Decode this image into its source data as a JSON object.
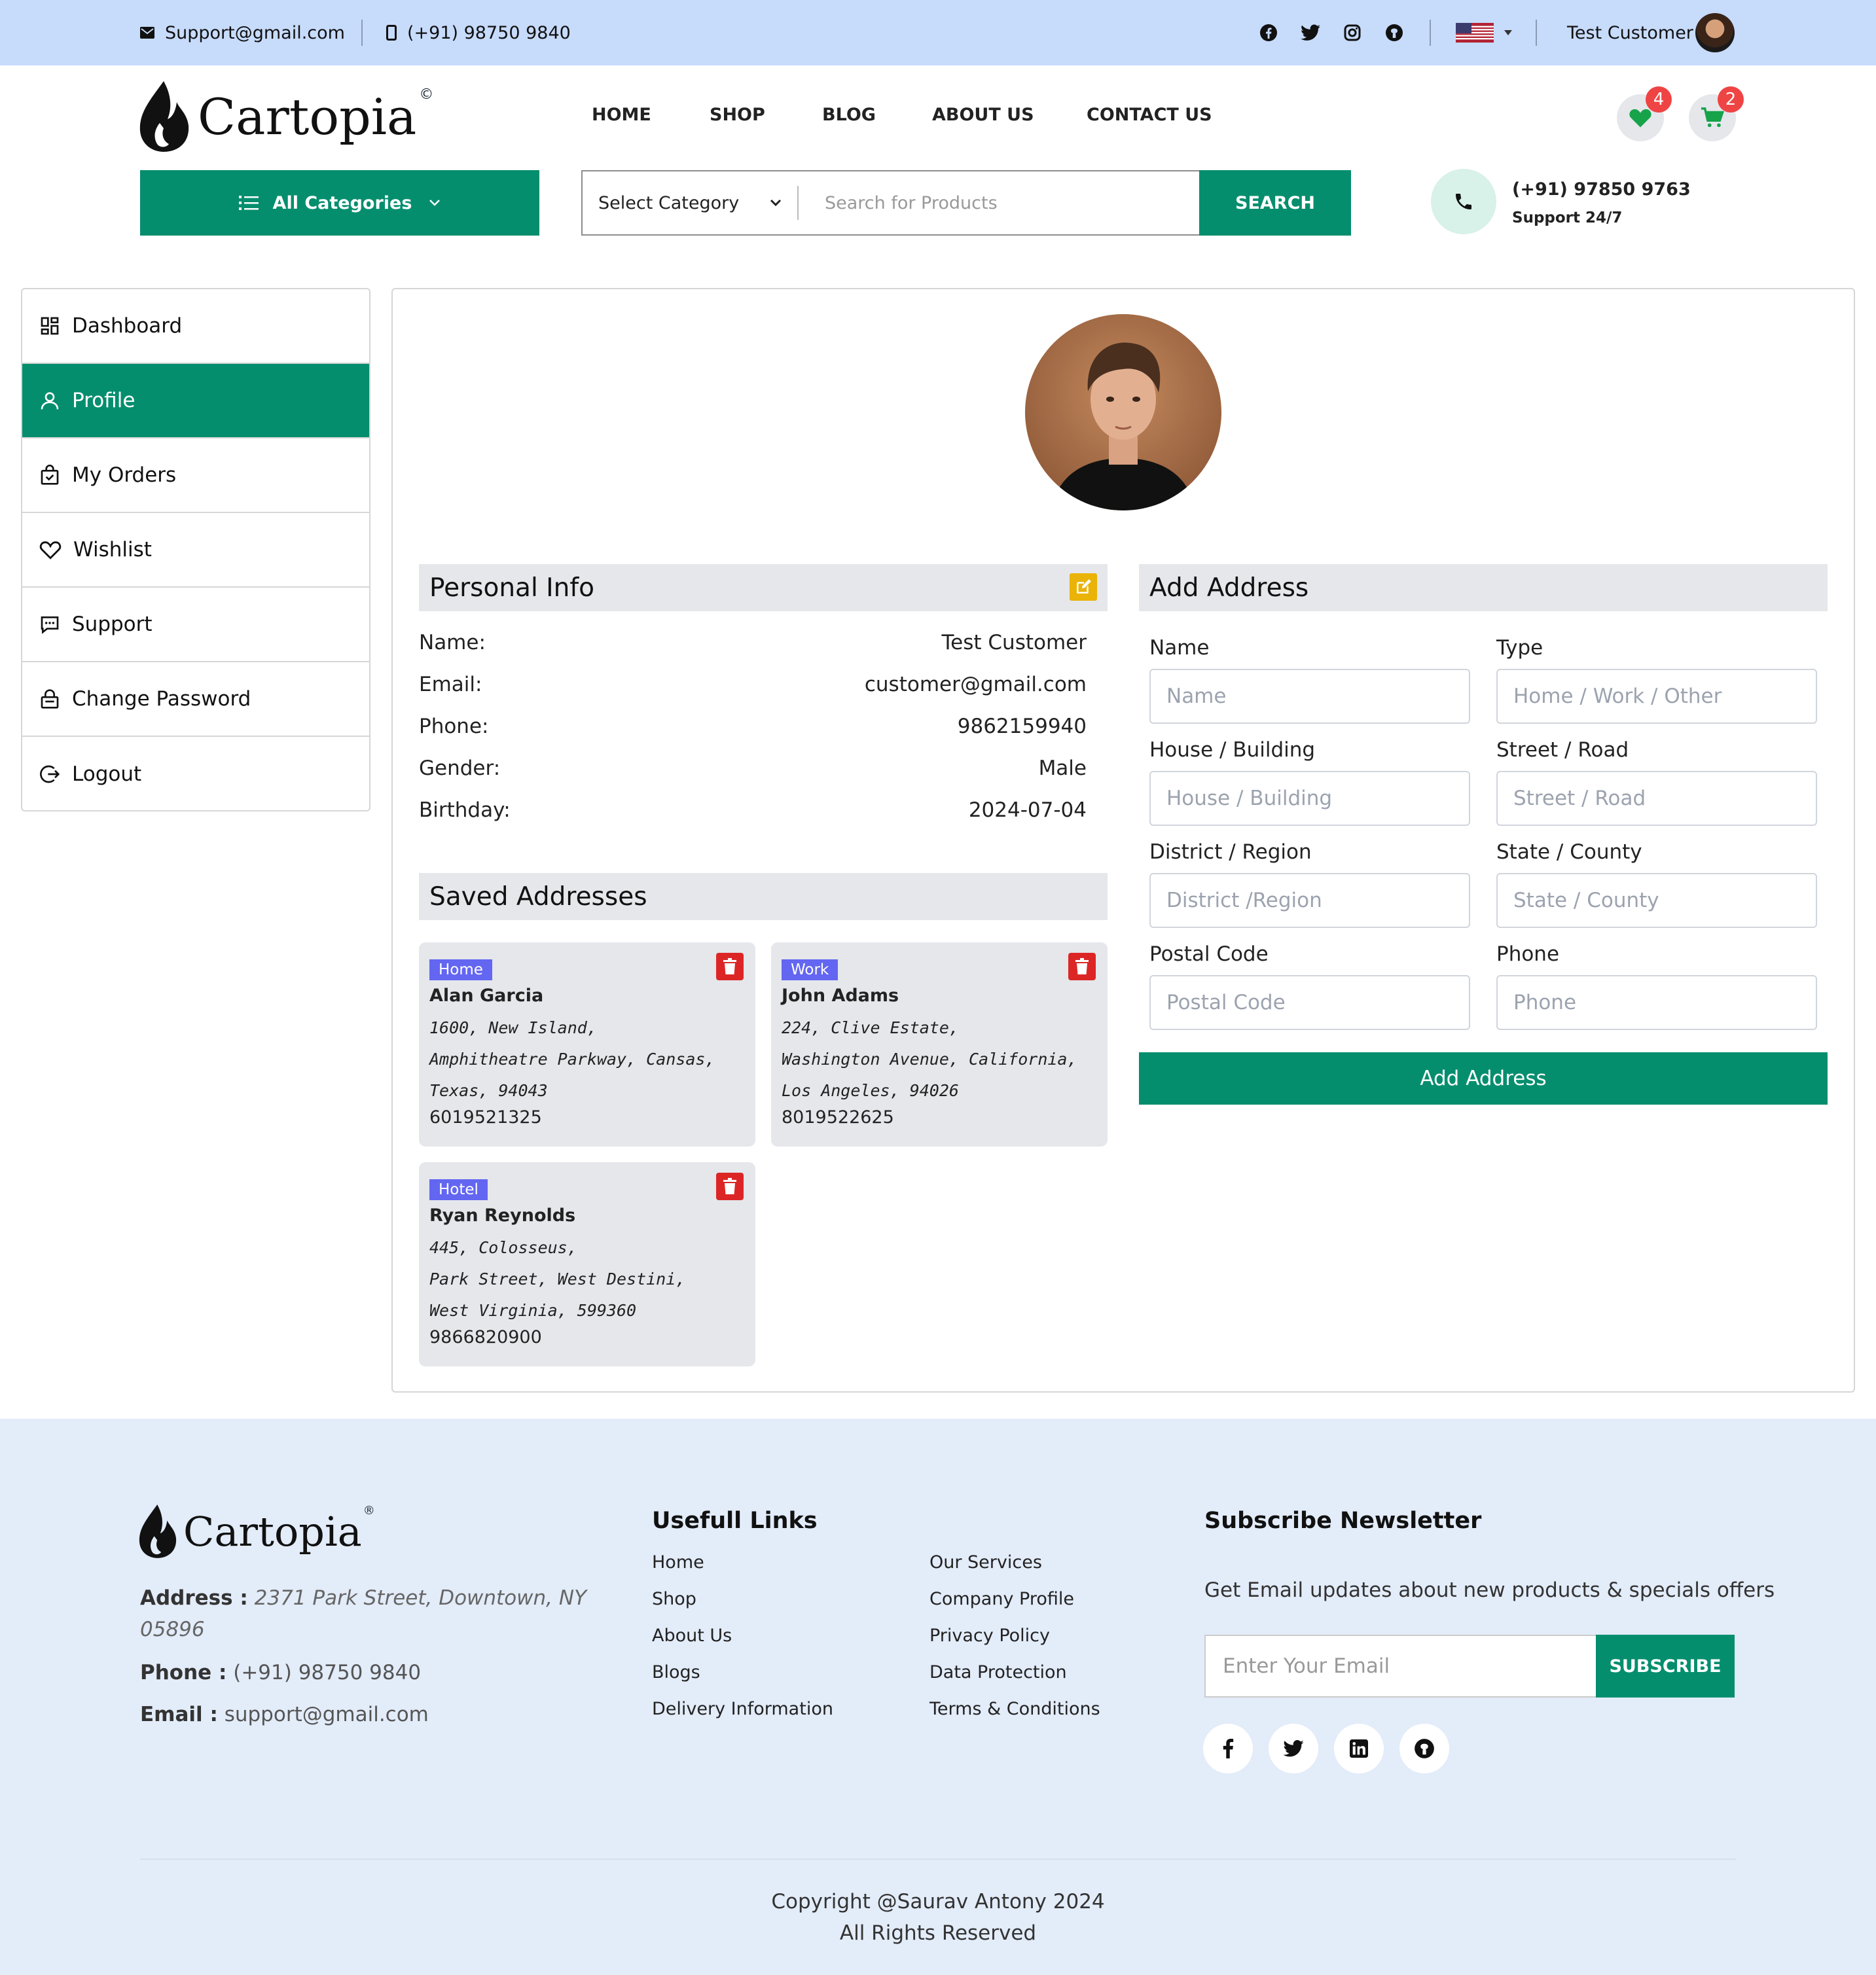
{
  "topbar": {
    "email": "Support@gmail.com",
    "phone": "(+91) 98750 9840",
    "user_name": "Test Customer",
    "social_icons": [
      "facebook-icon",
      "twitter-icon",
      "instagram-icon",
      "github-icon"
    ]
  },
  "header": {
    "brand": "Cartopia",
    "brand_mark": "©",
    "nav": [
      "HOME",
      "SHOP",
      "BLOG",
      "ABOUT US",
      "CONTACT US"
    ],
    "wishlist_count": "4",
    "cart_count": "2",
    "all_categories": "All Categories",
    "select_category": "Select Category",
    "search_placeholder": "Search for Products",
    "search_button": "SEARCH",
    "support_phone": "(+91) 97850 9763",
    "support_label": "Support 24/7"
  },
  "sidebar": {
    "items": [
      {
        "label": "Dashboard",
        "icon": "dashboard-icon"
      },
      {
        "label": "Profile",
        "icon": "user-icon"
      },
      {
        "label": "My Orders",
        "icon": "shopping-bag-icon"
      },
      {
        "label": "Wishlist",
        "icon": "heart-icon"
      },
      {
        "label": "Support",
        "icon": "chat-icon"
      },
      {
        "label": "Change Password",
        "icon": "lock-icon"
      },
      {
        "label": "Logout",
        "icon": "logout-icon"
      }
    ],
    "active": "Profile"
  },
  "personal_info": {
    "title": "Personal Info",
    "rows": [
      {
        "label": "Name:",
        "value": "Test Customer"
      },
      {
        "label": "Email:",
        "value": "customer@gmail.com"
      },
      {
        "label": "Phone:",
        "value": "9862159940"
      },
      {
        "label": "Gender:",
        "value": "Male"
      },
      {
        "label": "Birthday:",
        "value": "2024-07-04"
      }
    ]
  },
  "saved_addresses": {
    "title": "Saved Addresses",
    "cards": [
      {
        "tag": "Home",
        "name": "Alan Garcia",
        "lines": [
          "1600, New Island,",
          "Amphitheatre Parkway, Cansas,",
          "Texas, 94043"
        ],
        "phone": "6019521325"
      },
      {
        "tag": "Work",
        "name": "John Adams",
        "lines": [
          "224, Clive Estate,",
          "Washington Avenue, California,",
          "Los Angeles, 94026"
        ],
        "phone": "8019522625"
      },
      {
        "tag": "Hotel",
        "name": "Ryan Reynolds",
        "lines": [
          "445, Colosseus,",
          "Park Street, West Destini,",
          "West Virginia, 599360"
        ],
        "phone": "9866820900"
      }
    ]
  },
  "add_address": {
    "title": "Add Address",
    "fields": [
      {
        "label": "Name",
        "placeholder": "Name"
      },
      {
        "label": "Type",
        "placeholder": "Home / Work / Other"
      },
      {
        "label": "House / Building",
        "placeholder": "House / Building"
      },
      {
        "label": "Street / Road",
        "placeholder": "Street / Road"
      },
      {
        "label": "District / Region",
        "placeholder": "District /Region"
      },
      {
        "label": "State / County",
        "placeholder": "State / County"
      },
      {
        "label": "Postal Code",
        "placeholder": "Postal Code"
      },
      {
        "label": "Phone",
        "placeholder": "Phone"
      }
    ],
    "button": "Add Address"
  },
  "footer": {
    "brand": "Cartopia",
    "brand_mark": "®",
    "address_label": "Address :",
    "address_value_1": "2371 Park Street, Downtown, NY",
    "address_value_2": "05896",
    "phone_label": "Phone :",
    "phone_value": "(+91) 98750 9840",
    "email_label": "Email :",
    "email_value": "support@gmail.com",
    "links_title": "Usefull Links",
    "links_col1": [
      "Home",
      "Shop",
      "About Us",
      "Blogs",
      "Delivery Information"
    ],
    "links_col2": [
      "Our Services",
      "Company Profile",
      "Privacy Policy",
      "Data Protection",
      "Terms & Conditions"
    ],
    "newsletter_title": "Subscribe Newsletter",
    "newsletter_text": "Get Email updates about new products & specials offers",
    "email_placeholder": "Enter Your Email",
    "subscribe_button": "SUBSCRIBE",
    "copyright": "Copyright @Saurav Antony 2024",
    "rights": "All Rights Reserved"
  },
  "colors": {
    "accent": "#058e6e",
    "topbar": "#c7dbfb",
    "footer": "#e3ecf9",
    "badge": "#ef4444",
    "tag": "#6366f1",
    "delete": "#dc2626",
    "edit": "#eab308"
  }
}
